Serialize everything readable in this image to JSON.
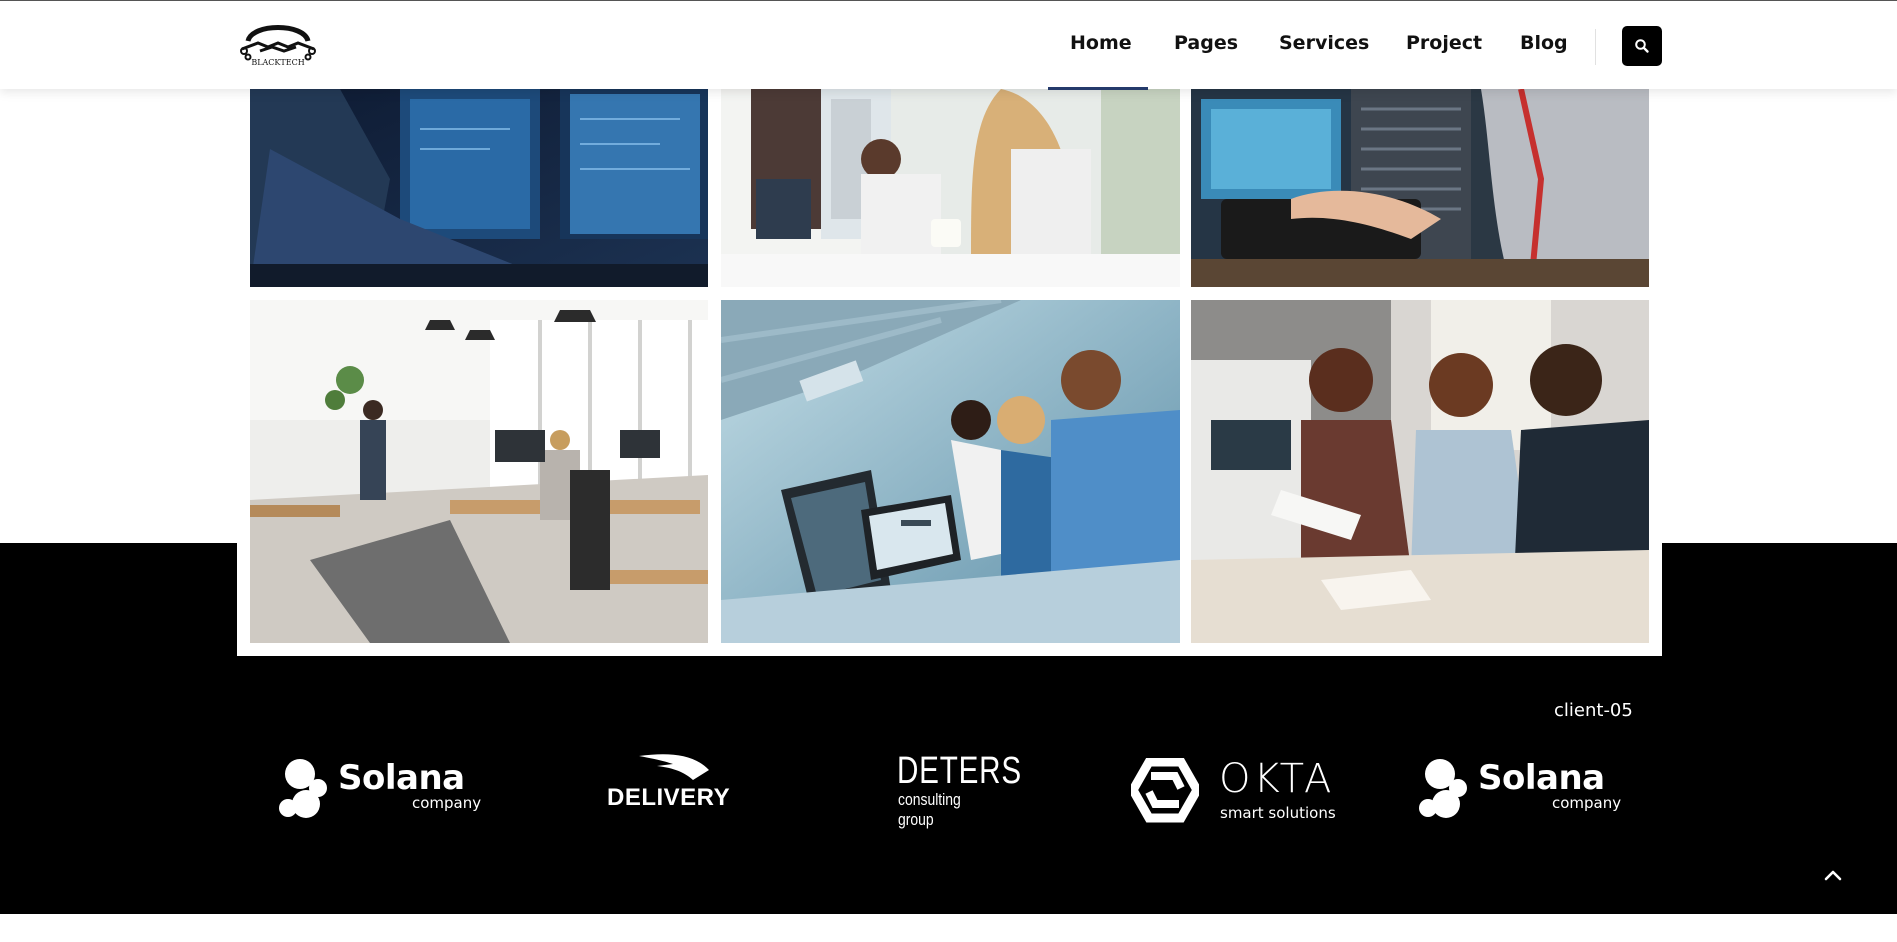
{
  "header": {
    "logo_text": "BLACKTECH",
    "nav": [
      {
        "label": "Home"
      },
      {
        "label": "Pages"
      },
      {
        "label": "Services"
      },
      {
        "label": "Project"
      },
      {
        "label": "Blog"
      }
    ],
    "active_nav": "Home",
    "search_icon": "search-icon"
  },
  "gallery": {
    "images": [
      {
        "name": "engineer-at-monitors-photo"
      },
      {
        "name": "team-at-computer-desk-photo"
      },
      {
        "name": "woman-typing-at-server-rack-photo"
      },
      {
        "name": "open-office-photo"
      },
      {
        "name": "colleagues-at-screens-photo"
      },
      {
        "name": "team-reviewing-papers-photo"
      }
    ]
  },
  "clients": {
    "label": "client-05",
    "logos": [
      {
        "name": "Solana",
        "sub": "company"
      },
      {
        "name": "DELIVERY"
      },
      {
        "name": "DETERS",
        "sub": "consulting group"
      },
      {
        "name": "OKTA",
        "sub": "smart solutions"
      },
      {
        "name": "Solana",
        "sub": "company"
      }
    ]
  },
  "colors": {
    "accent": "#243a6b",
    "footer_bg": "#000000",
    "header_bg": "#ffffff"
  },
  "scroll_top_icon": "chevron-up-icon"
}
